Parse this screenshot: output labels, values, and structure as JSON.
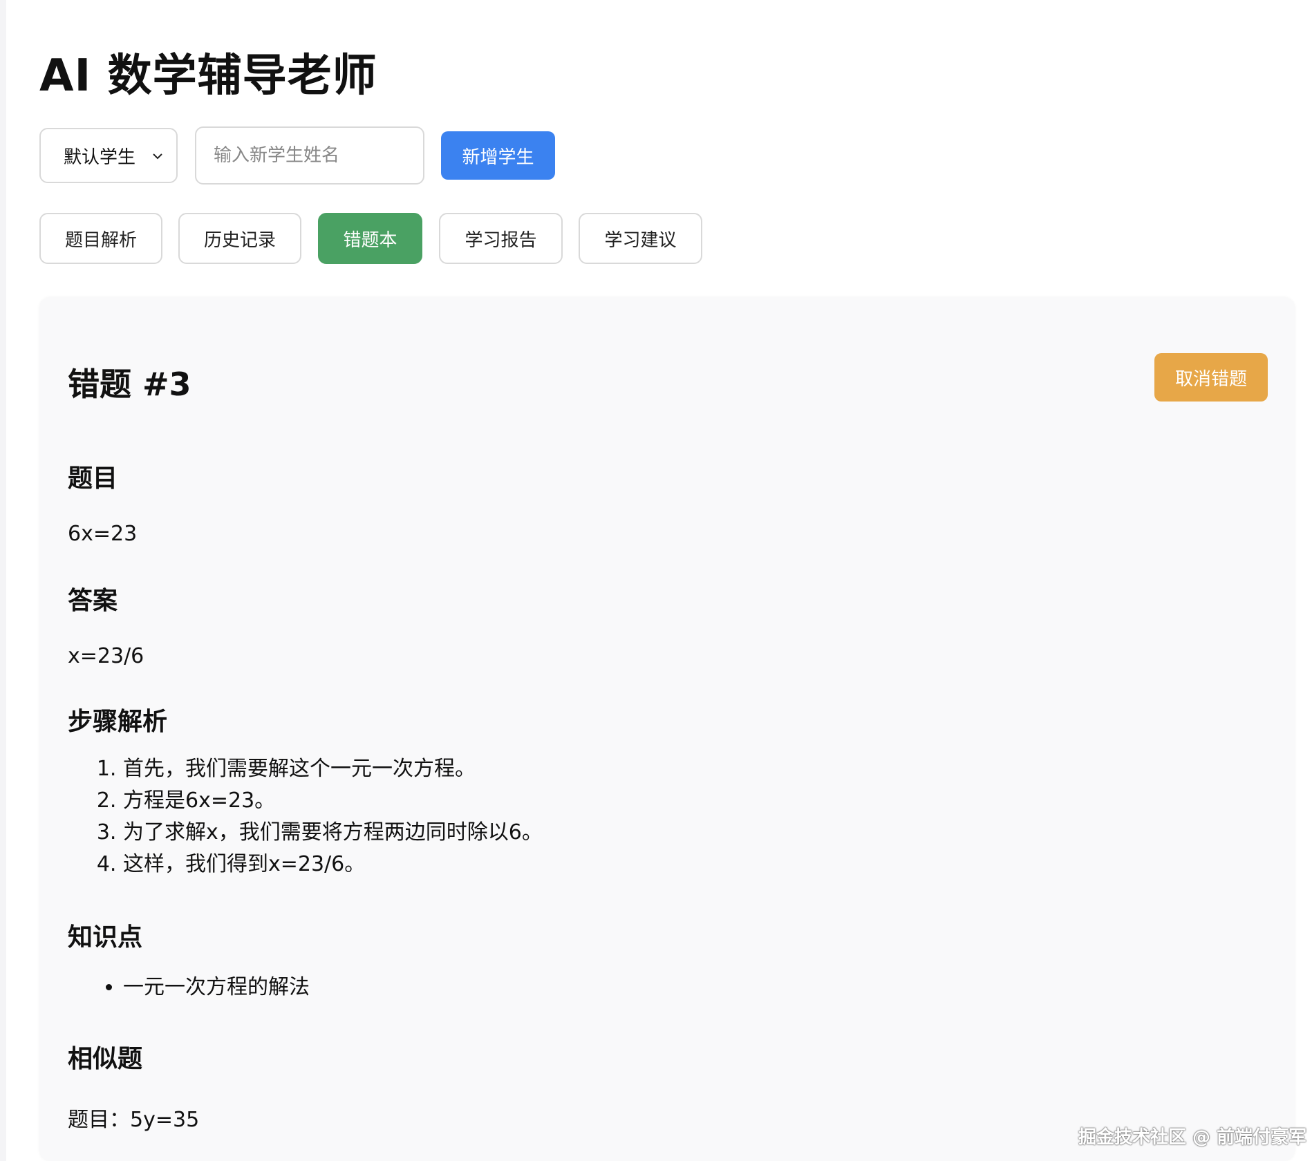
{
  "app": {
    "title": "AI 数学辅导老师"
  },
  "student_bar": {
    "selected_student": "默认学生",
    "new_student_placeholder": "输入新学生姓名",
    "new_student_value": "",
    "add_button": "新增学生"
  },
  "tabs": [
    {
      "label": "题目解析",
      "active": false
    },
    {
      "label": "历史记录",
      "active": false
    },
    {
      "label": "错题本",
      "active": true
    },
    {
      "label": "学习报告",
      "active": false
    },
    {
      "label": "学习建议",
      "active": false
    }
  ],
  "mistake": {
    "title": "错题 #3",
    "cancel_button": "取消错题",
    "question_heading": "题目",
    "question": "6x=23",
    "answer_heading": "答案",
    "answer": "x=23/6",
    "steps_heading": "步骤解析",
    "steps": [
      "首先，我们需要解这个一元一次方程。",
      "方程是6x=23。",
      "为了求解x，我们需要将方程两边同时除以6。",
      "这样，我们得到x=23/6。"
    ],
    "knowledge_heading": "知识点",
    "knowledge_points": [
      "一元一次方程的解法"
    ],
    "similar_heading": "相似题",
    "similar_question": "题目：5y=35"
  },
  "watermark": "掘金技术社区 @ 前端付豪军",
  "colors": {
    "primary_blue": "#3b82f0",
    "active_tab_green": "#4aa163",
    "cancel_orange": "#e7a748",
    "card_background": "#f9f9fa"
  },
  "icons": {
    "select_arrow": "chevron-down-icon"
  }
}
